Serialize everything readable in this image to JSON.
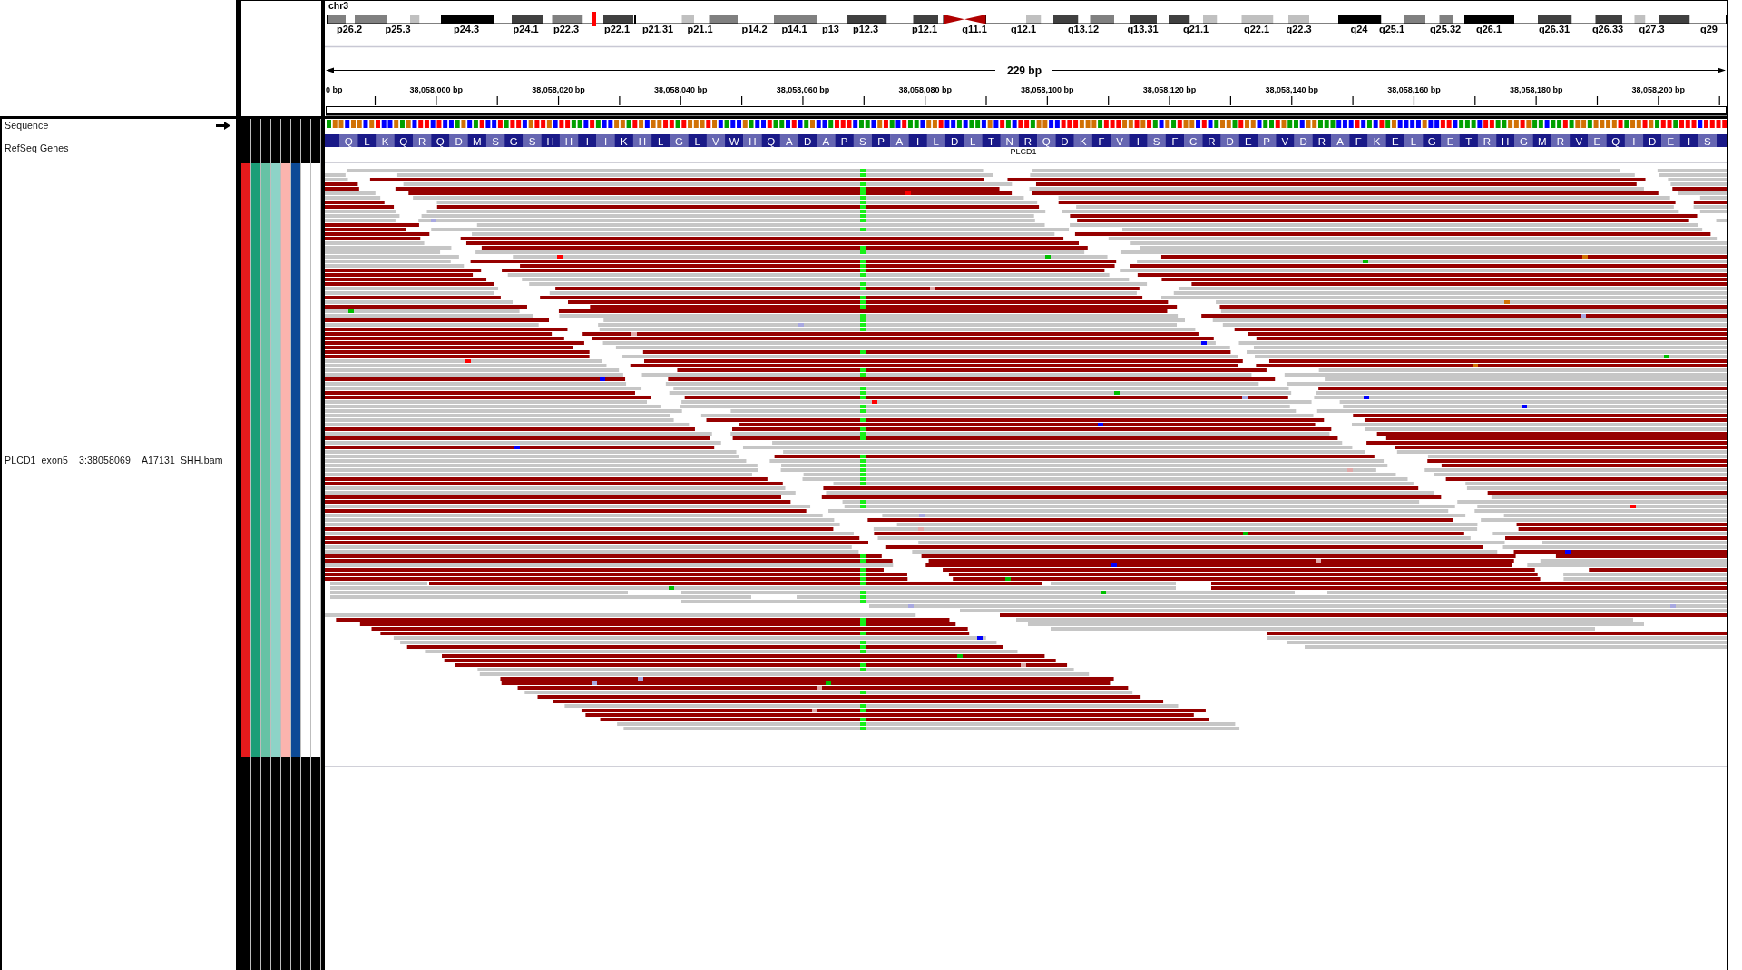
{
  "ideogram": {
    "chromosome": "chr3",
    "band_labels": [
      "p26.2",
      "p25.3",
      "p24.3",
      "p24.1",
      "p22.3",
      "p22.1",
      "p21.31",
      "p21.1",
      "p14.2",
      "p14.1",
      "p13",
      "p12.3",
      "p12.1",
      "q11.1",
      "q12.1",
      "q13.12",
      "q13.31",
      "q21.1",
      "q22.1",
      "q22.3",
      "q24",
      "q25.1",
      "q25.32",
      "q26.1",
      "q26.31",
      "q26.33",
      "q27.3",
      "q29"
    ]
  },
  "ruler": {
    "span": "229 bp",
    "tick_labels": [
      "0 bp",
      "38,058,000 bp",
      "38,058,020 bp",
      "38,058,040 bp",
      "38,058,060 bp",
      "38,058,080 bp",
      "38,058,100 bp",
      "38,058,120 bp",
      "38,058,140 bp",
      "38,058,160 bp",
      "38,058,180 bp",
      "38,058,200 bp"
    ]
  },
  "tracks": [
    {
      "kind": "sequence",
      "name": "Sequence",
      "forward_strand": true
    },
    {
      "kind": "genes",
      "name": "RefSeq Genes",
      "gene": "PLCD1",
      "amino_acids": [
        "Q",
        "L",
        "K",
        "Q",
        "R",
        "Q",
        "D",
        "M",
        "S",
        "G",
        "S",
        "H",
        "H",
        "I",
        "I",
        "K",
        "H",
        "L",
        "G",
        "L",
        "V",
        "W",
        "H",
        "Q",
        "A",
        "D",
        "A",
        "P",
        "S",
        "P",
        "A",
        "I",
        "L",
        "D",
        "L",
        "T",
        "N",
        "R",
        "Q",
        "D",
        "K",
        "F",
        "V",
        "I",
        "S",
        "F",
        "C",
        "R",
        "D",
        "E",
        "P",
        "V",
        "D",
        "R",
        "A",
        "F",
        "K",
        "E",
        "L",
        "G",
        "E",
        "T",
        "R",
        "H",
        "G",
        "M",
        "R",
        "V",
        "E",
        "Q",
        "I",
        "D",
        "E",
        "I",
        "S"
      ]
    },
    {
      "kind": "alignments",
      "name": "PLCD1_exon5__3:38058069__A17131_SHH.bam"
    }
  ],
  "attributes": [
    {
      "color": "#e41a1c"
    },
    {
      "color": "#1b9e77"
    },
    {
      "color": "#66c2a5"
    },
    {
      "color": "#8dd3c7"
    },
    {
      "color": "#fbb4ae"
    },
    {
      "color": "#0c4a96"
    },
    {
      "color": "#ffffff"
    },
    {
      "color": "#ffffff"
    }
  ]
}
